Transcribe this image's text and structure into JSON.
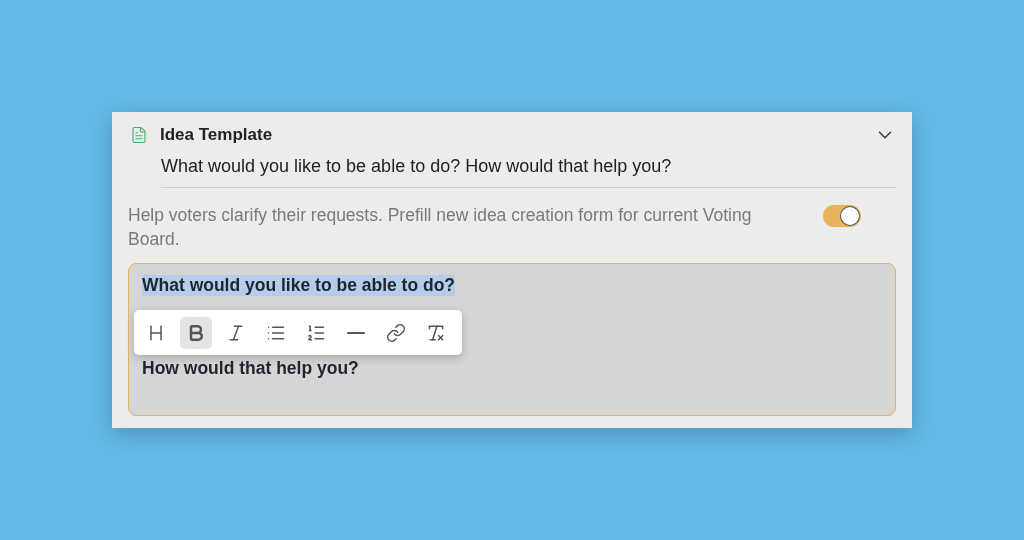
{
  "template": {
    "title": "Idea Template",
    "expanded": true,
    "preview": "What would you like to be able to do? How would that help you?"
  },
  "setting": {
    "description": "Help voters clarify their requests. Prefill new idea creation form for current Voting Board.",
    "on": true
  },
  "editor": {
    "lines": [
      {
        "text": "What would you like to be able to do?",
        "selected": true
      },
      {
        "text": "How would that help you?",
        "selected": false
      }
    ],
    "toolbar": [
      {
        "kind": "heading",
        "selected": false
      },
      {
        "kind": "bold",
        "selected": true
      },
      {
        "kind": "italic",
        "selected": false
      },
      {
        "kind": "bullets",
        "selected": false
      },
      {
        "kind": "numbered",
        "selected": false
      },
      {
        "kind": "rule",
        "selected": false
      },
      {
        "kind": "link",
        "selected": false
      },
      {
        "kind": "clear",
        "selected": false
      }
    ]
  }
}
